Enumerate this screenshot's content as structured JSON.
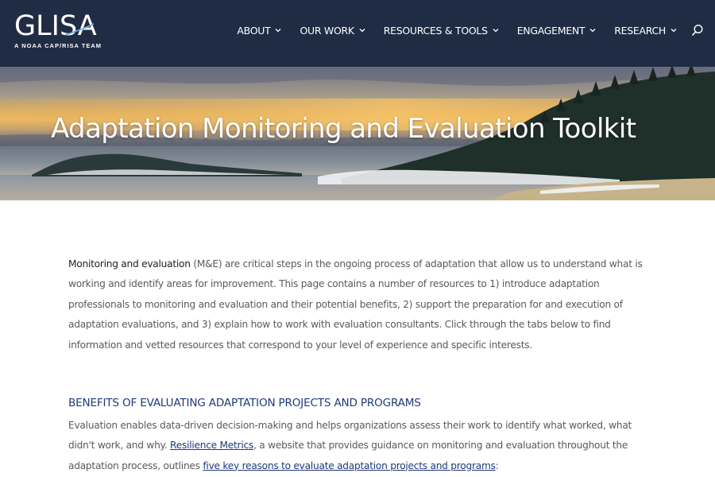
{
  "header": {
    "logo_text": "GLISA",
    "logo_tagline": "A NOAA CAP/RISA TEAM",
    "background_color": "#1f2c44",
    "nav": [
      {
        "label": "ABOUT"
      },
      {
        "label": "OUR WORK"
      },
      {
        "label": "RESOURCES & TOOLS"
      },
      {
        "label": "ENGAGEMENT"
      },
      {
        "label": "RESEARCH"
      }
    ],
    "search_icon": "search-icon"
  },
  "hero": {
    "title": "Adaptation Monitoring and Evaluation Toolkit"
  },
  "intro": {
    "lead_bold": "Monitoring and evaluation",
    "text": " (M&E) are critical steps in the ongoing process of adaptation that allow us to understand what is working and identify areas for improvement. This page contains a number of resources to 1) introduce adaptation professionals to monitoring and evaluation and their potential benefits, 2) support the preparation for and execution of adaptation evaluations, and 3) explain how to work with evaluation consultants. Click through the tabs below to find information and vetted resources that correspond to your level of experience and specific interests."
  },
  "benefits": {
    "heading": "BENEFITS OF EVALUATING ADAPTATION PROJECTS AND PROGRAMS",
    "text_before": "Evaluation enables data-driven decision-making and helps organizations assess their work to identify what worked, what didn't work, and why. ",
    "link1": "Resilience Metrics",
    "text_middle": ", a website that provides guidance on monitoring and evaluation throughout the adaptation process, outlines ",
    "link2": "five key reasons to evaluate adaptation projects and programs",
    "text_after": ":"
  },
  "colors": {
    "heading_blue": "#1e3a7a",
    "body_gray": "#5a5a5a"
  }
}
